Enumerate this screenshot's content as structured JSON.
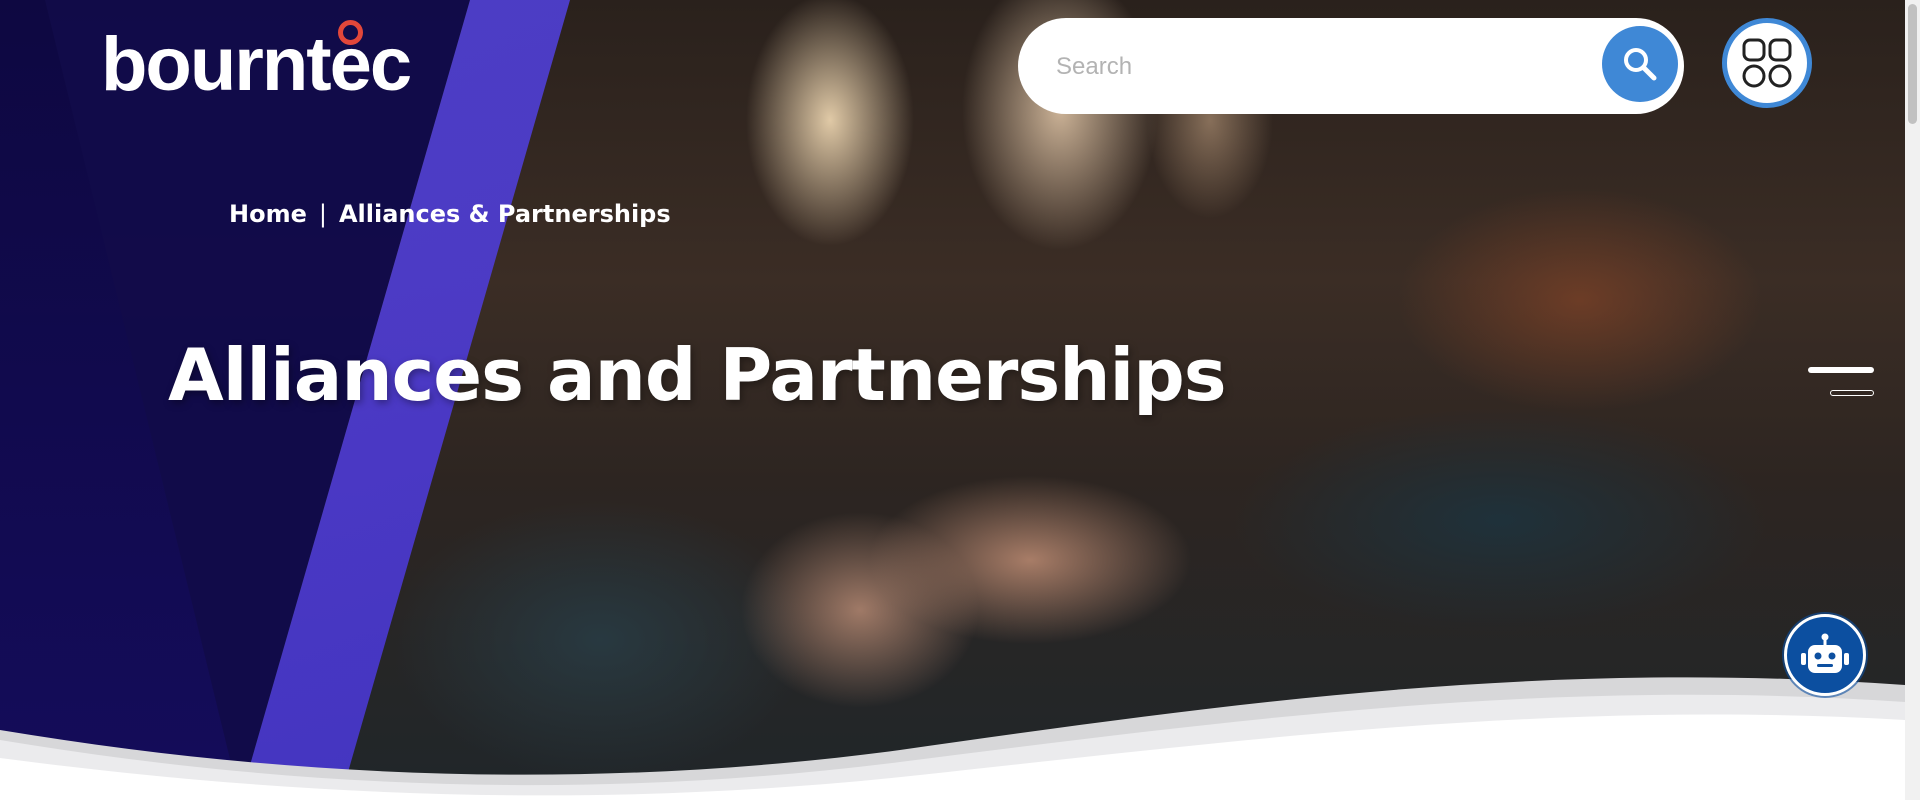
{
  "header": {
    "logo_text": "bourntec",
    "search": {
      "placeholder": "Search"
    }
  },
  "breadcrumb": {
    "home": "Home",
    "separator": "|",
    "current": "Alliances & Partnerships"
  },
  "hero": {
    "title": "Alliances and Partnerships"
  },
  "icons": {
    "logo_mark": "ring-icon",
    "search": "search-icon",
    "apps": "apps-grid-icon",
    "chatbot": "robot-icon"
  },
  "colors": {
    "brand_dark": "#110a4a",
    "brand_blue": "#4d3ad6",
    "accent_blue": "#3f88d6",
    "logo_accent": "#e2473a",
    "chatbot_blue": "#0c4fa0"
  }
}
